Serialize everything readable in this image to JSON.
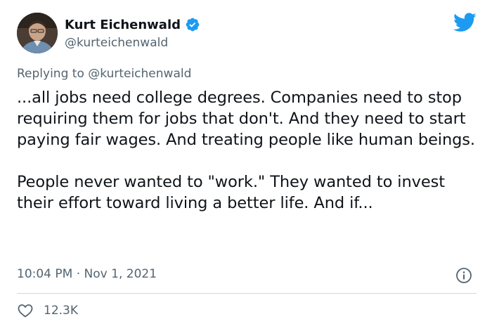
{
  "author": {
    "name": "Kurt Eichenwald",
    "handle": "@kurteichenwald",
    "verified": true
  },
  "reply": {
    "prefix": "Replying to",
    "handle": "@kurteichenwald"
  },
  "tweet": {
    "text": "...all jobs need college degrees. Companies need to stop requiring them for jobs that don't. And they need to start paying fair wages. And treating people like human beings.\n\nPeople never wanted to \"work.\" They wanted to invest their effort toward living a better life. And if...",
    "time": "10:04 PM",
    "separator": "·",
    "date": "Nov 1, 2021",
    "likes": "12.3K"
  },
  "icons": {
    "brand": "twitter-bird-icon",
    "verified": "verified-badge-icon",
    "info": "info-icon",
    "like": "heart-icon"
  },
  "colors": {
    "brand_blue": "#1d9bf0",
    "secondary_text": "#536471",
    "primary_text": "#0f1419"
  }
}
